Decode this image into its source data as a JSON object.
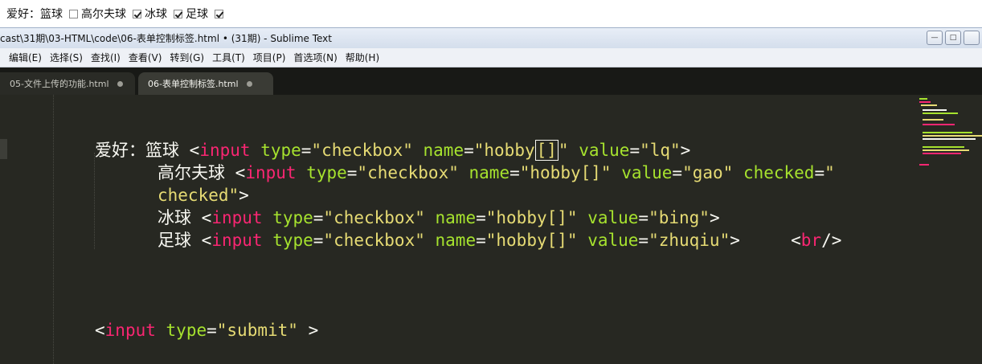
{
  "form_strip": {
    "label": "爱好：篮球",
    "items": [
      {
        "label": "篮球",
        "checked": false
      },
      {
        "label": "高尔夫球",
        "checked": true
      },
      {
        "label": "冰球",
        "checked": true
      },
      {
        "label": "足球",
        "checked": true
      }
    ],
    "label_golf": "高尔夫球",
    "label_ice": "冰球",
    "label_soccer": "足球"
  },
  "window": {
    "title": "cast\\31期\\03-HTML\\code\\06-表单控制标签.html • (31期) - Sublime Text",
    "minimize": "—",
    "maximize": "□",
    "close": ""
  },
  "menu": [
    "编辑(E)",
    "选择(S)",
    "查找(I)",
    "查看(V)",
    "转到(G)",
    "工具(T)",
    "项目(P)",
    "首选项(N)",
    "帮助(H)"
  ],
  "tabs": [
    {
      "label": "05-文件上传的功能.html",
      "active": false
    },
    {
      "label": "06-表单控制标签.html",
      "active": true
    }
  ],
  "code": {
    "l1_prefix": "爱好：篮球 ",
    "l2_prefix": "高尔夫球 ",
    "l4_prefix": "冰球 ",
    "l5_prefix": "足球 ",
    "tag_input": "input",
    "tag_br": "br",
    "attr_type": "type",
    "attr_name": "name",
    "attr_value": "value",
    "attr_checked": "checked",
    "str_checkbox": "\"checkbox\"",
    "str_hobby_open": "\"hobby",
    "str_brackets": "[]",
    "str_close": "\"",
    "str_hobby": "\"hobby[]\"",
    "str_lq": "\"lq\"",
    "str_gao": "\"gao\"",
    "str_checked_open": "\"",
    "str_checked_close": "checked\"",
    "str_bing": "\"bing\"",
    "str_zhuqiu": "\"zhuqiu\"",
    "str_submit": "\"submit\""
  },
  "colors": {
    "editor_bg": "#272822",
    "tag": "#f92672",
    "attr": "#a6e22e",
    "string": "#e6db74"
  }
}
